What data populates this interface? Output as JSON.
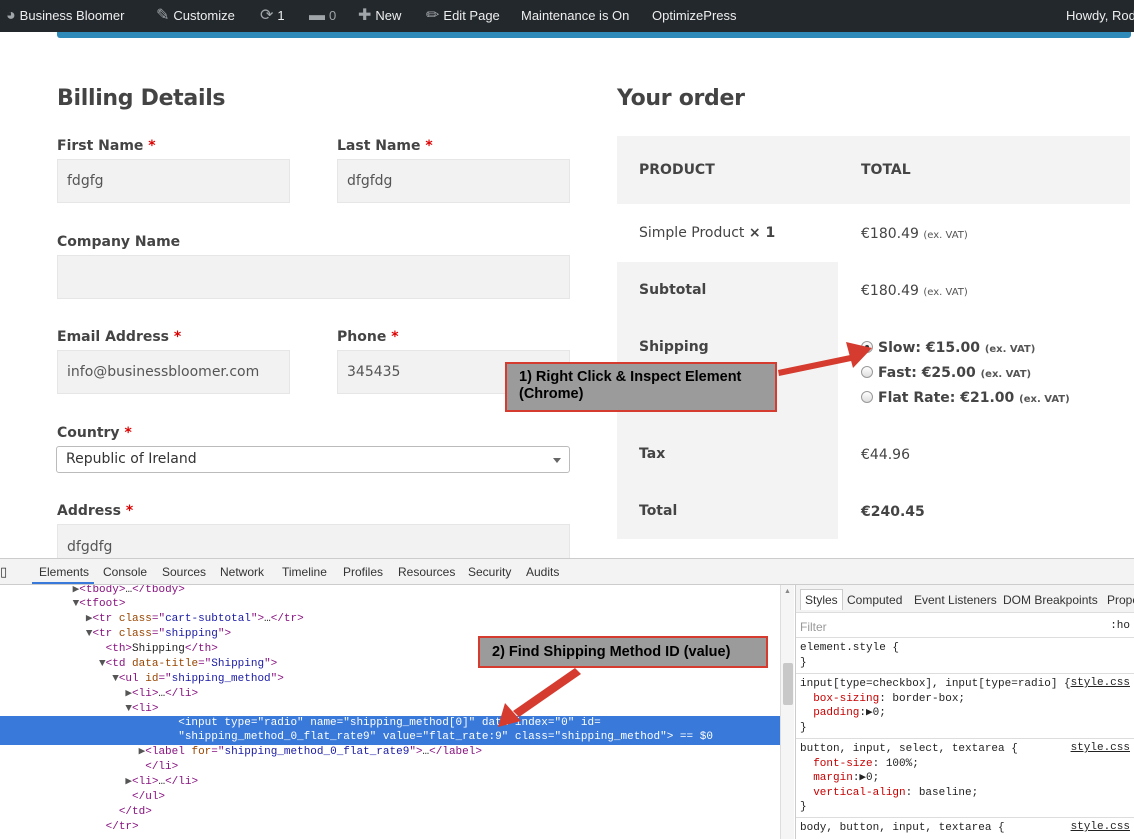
{
  "adminbar": {
    "site": "Business Bloomer",
    "customize": "Customize",
    "updates": "1",
    "comments": "0",
    "new": "New",
    "edit": "Edit Page",
    "maintenance": "Maintenance is On",
    "optimize": "OptimizePress",
    "howdy": "Howdy, Rod"
  },
  "billing": {
    "title": "Billing Details",
    "first_name_label": "First Name",
    "first_name": "fdgfg",
    "last_name_label": "Last Name",
    "last_name": "dfgfdg",
    "company_label": "Company Name",
    "company": "",
    "email_label": "Email Address",
    "email": "info@businessbloomer.com",
    "phone_label": "Phone",
    "phone": "345435",
    "country_label": "Country",
    "country": "Republic of Ireland",
    "address_label": "Address",
    "address": "dfgdfg",
    "required": "*"
  },
  "order": {
    "title": "Your order",
    "col_product": "PRODUCT",
    "col_total": "TOTAL",
    "product": "Simple Product",
    "qty": "× 1",
    "product_total": "€180.49",
    "exvat": "(ex. VAT)",
    "subtotal_label": "Subtotal",
    "subtotal": "€180.49",
    "shipping_label": "Shipping",
    "shipping_options": [
      {
        "label": "Slow: €15.00",
        "selected": true
      },
      {
        "label": "Fast: €25.00",
        "selected": false
      },
      {
        "label": "Flat Rate: €21.00",
        "selected": false
      }
    ],
    "tax_label": "Tax",
    "tax": "€44.96",
    "total_label": "Total",
    "total": "€240.45"
  },
  "callouts": {
    "c1_line1": "1) Right Click & Inspect Element",
    "c1_line2": "(Chrome)",
    "c2": "2) Find Shipping Method ID (value)"
  },
  "devtools": {
    "tabs": [
      "Elements",
      "Console",
      "Sources",
      "Network",
      "Timeline",
      "Profiles",
      "Resources",
      "Security",
      "Audits"
    ],
    "style_tabs": [
      "Styles",
      "Computed",
      "Event Listeners",
      "DOM Breakpoints",
      "Prope"
    ],
    "filter": "Filter",
    "hov": ":ho"
  },
  "colors": {
    "adminbar": "#23282d",
    "accent": "#2e8ab8",
    "highlight": "#3879d9",
    "callout_border": "#d53b2e"
  }
}
